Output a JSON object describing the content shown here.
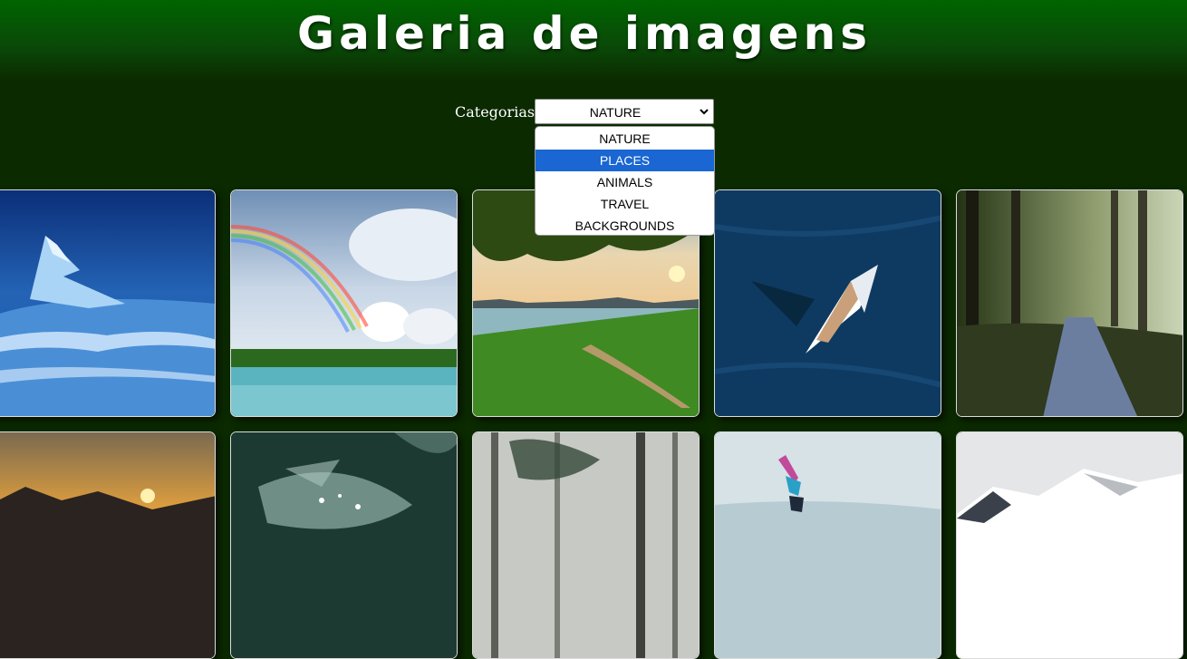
{
  "title": "Galeria de imagens",
  "filter": {
    "label": "Categorias",
    "selected": "NATURE",
    "options": [
      "NATURE",
      "PLACES",
      "ANIMALS",
      "TRAVEL",
      "BACKGROUNDS"
    ],
    "highlighted": "PLACES"
  },
  "colors": {
    "header_top": "#006400",
    "page_background": "#0b2a00",
    "option_highlight": "#1a66d2"
  },
  "gallery": {
    "images": [
      {
        "subject": "iceberg"
      },
      {
        "subject": "rainbow over lake"
      },
      {
        "subject": "tropical bay under tree"
      },
      {
        "subject": "sailboat aerial"
      },
      {
        "subject": "forest road with sun rays"
      },
      {
        "subject": "mountain sunset"
      },
      {
        "subject": "leaf with water drops"
      },
      {
        "subject": "misty forest"
      },
      {
        "subject": "kitesurfer"
      },
      {
        "subject": "snowy mountain"
      }
    ]
  }
}
